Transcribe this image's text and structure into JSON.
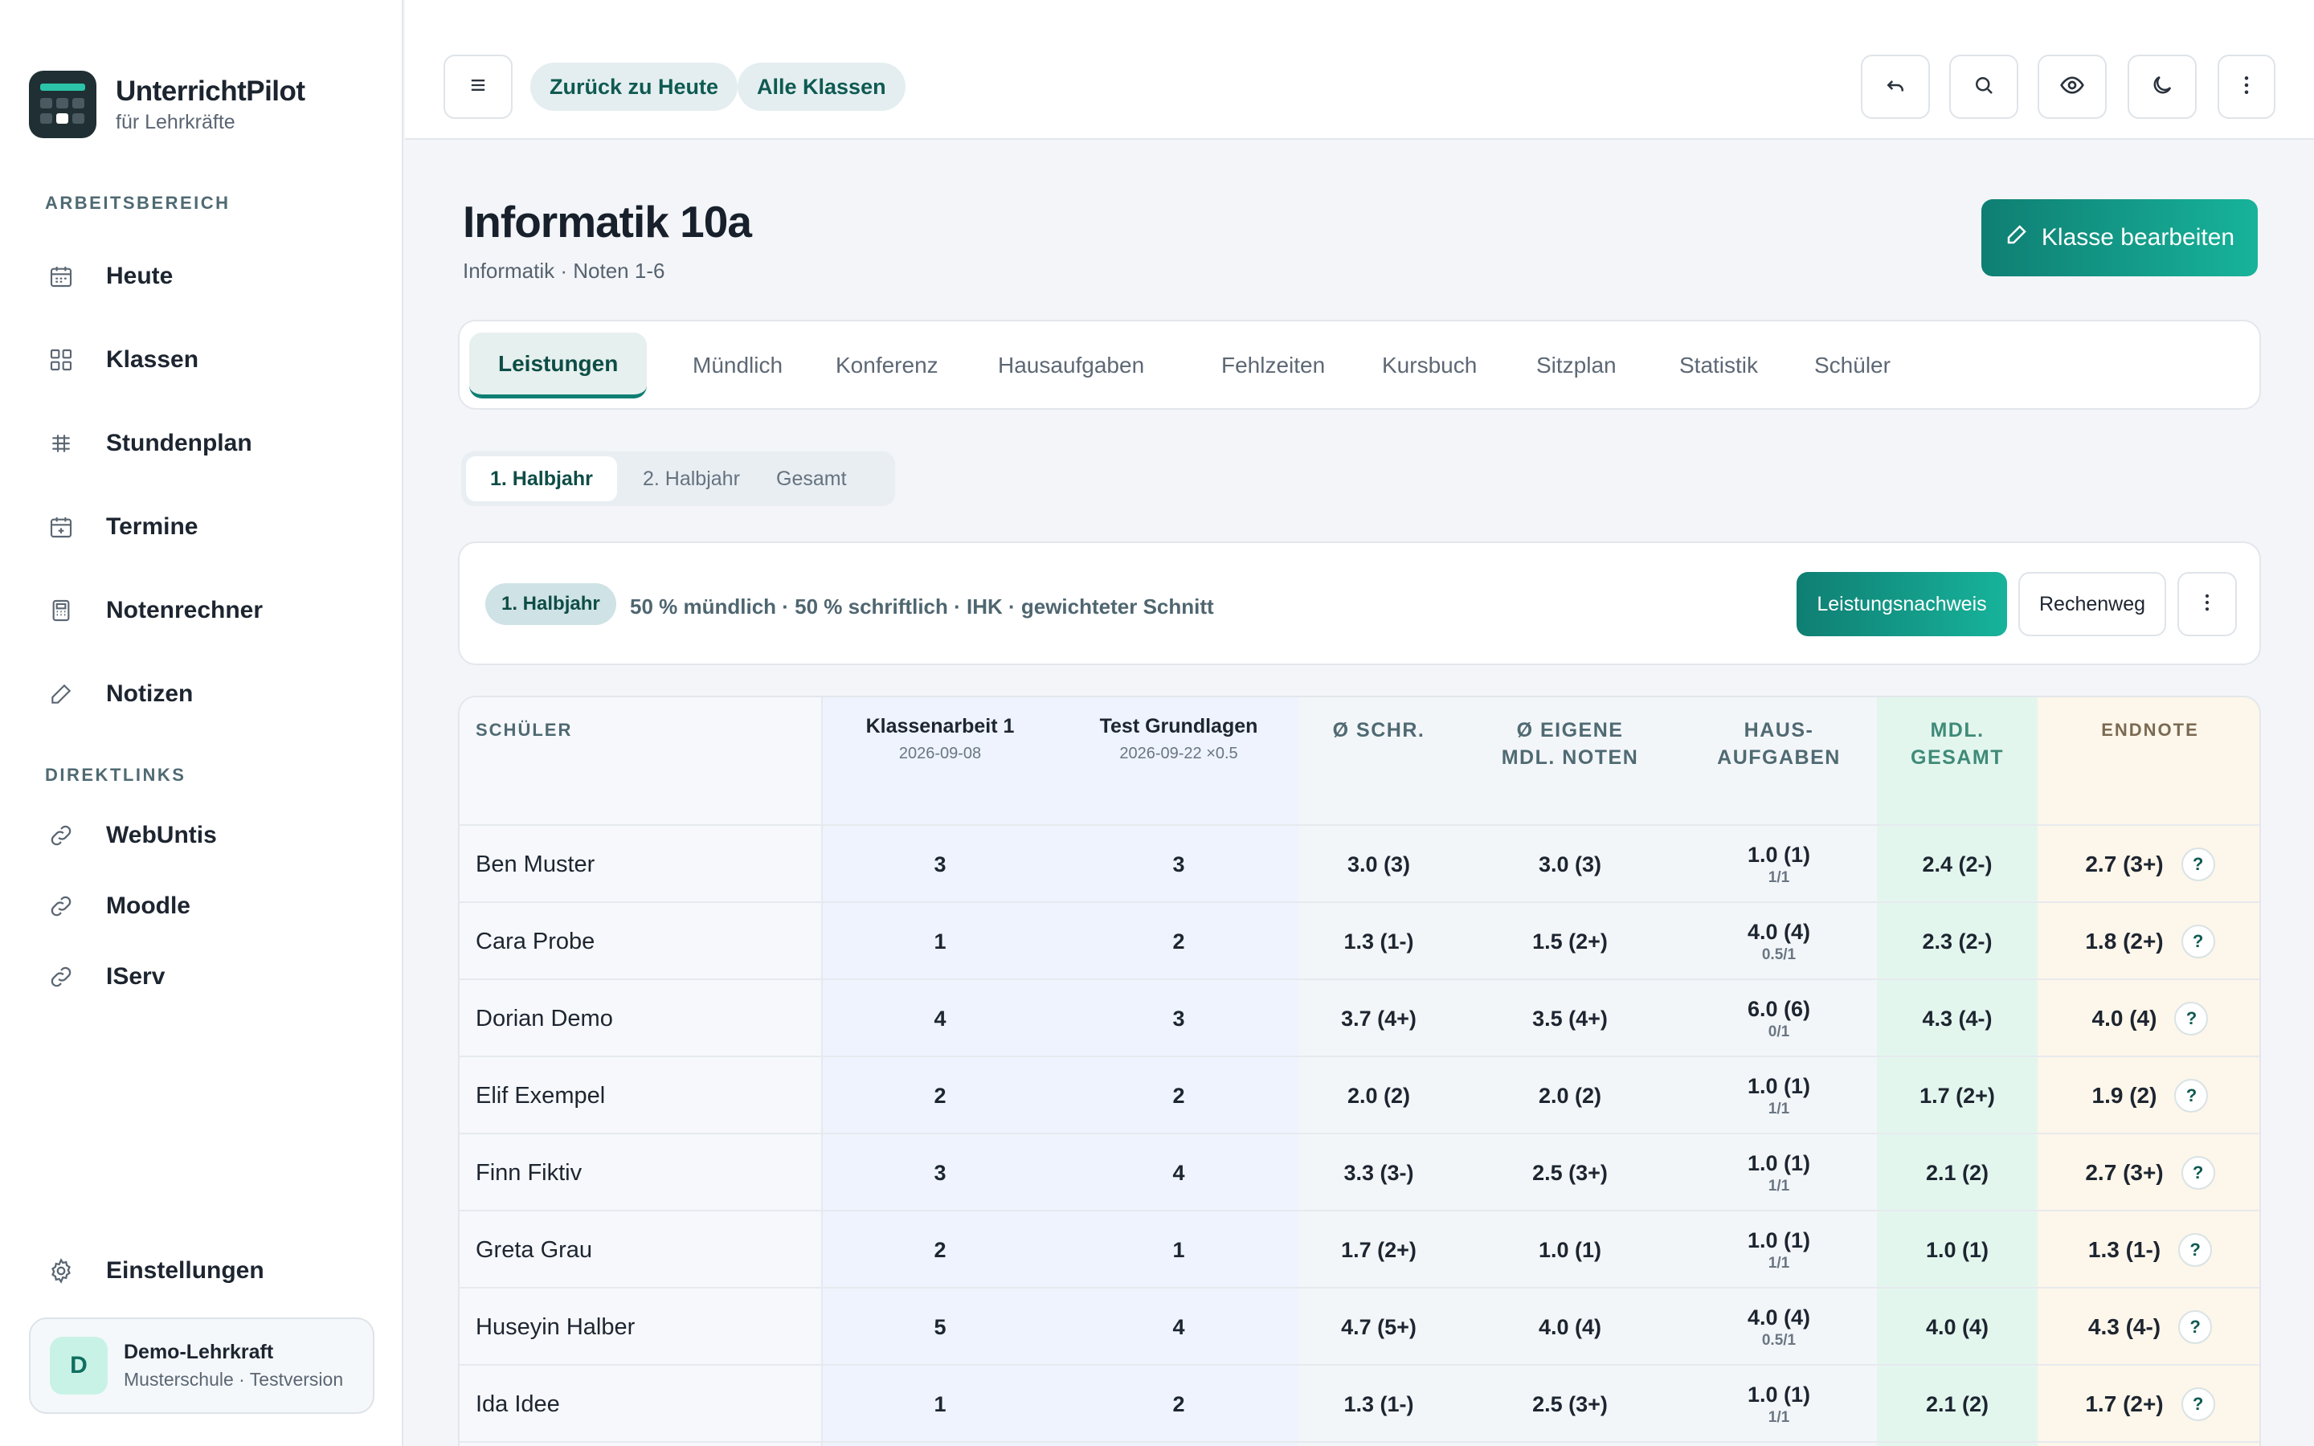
{
  "brand": {
    "title": "UnterrichtPilot",
    "subtitle": "für Lehrkräfte"
  },
  "sidebar": {
    "section_work": "ARBEITSBEREICH",
    "items": [
      {
        "label": "Heute",
        "icon": "calendar-icon"
      },
      {
        "label": "Klassen",
        "icon": "grid-icon"
      },
      {
        "label": "Stundenplan",
        "icon": "timetable-icon"
      },
      {
        "label": "Termine",
        "icon": "calendar-plus-icon"
      },
      {
        "label": "Notenrechner",
        "icon": "calculator-icon"
      },
      {
        "label": "Notizen",
        "icon": "pencil-icon"
      }
    ],
    "section_links": "DIREKTLINKS",
    "links": [
      {
        "label": "WebUntis",
        "icon": "link-icon"
      },
      {
        "label": "Moodle",
        "icon": "link-icon"
      },
      {
        "label": "IServ",
        "icon": "link-icon"
      }
    ],
    "settings_label": "Einstellungen",
    "user": {
      "initial": "D",
      "name": "Demo-Lehrkraft",
      "sub": "Musterschule · Testversion"
    }
  },
  "topbar": {
    "back_today": "Zurück zu Heute",
    "all_classes": "Alle Klassen"
  },
  "page": {
    "title": "Informatik 10a",
    "subtitle": "Informatik · Noten 1-6",
    "edit_button": "Klasse bearbeiten"
  },
  "tabs": [
    "Leistungen",
    "Mündlich",
    "Konferenz",
    "Hausaufgaben",
    "Fehlzeiten",
    "Kursbuch",
    "Sitzplan",
    "Statistik",
    "Schüler"
  ],
  "segments": [
    "1. Halbjahr",
    "2. Halbjahr",
    "Gesamt"
  ],
  "info": {
    "badge": "1. Halbjahr",
    "text": "50 % mündlich · 50 % schriftlich · IHK · gewichteter Schnitt",
    "primary_button": "Leistungsnachweis",
    "secondary_button": "Rechenweg"
  },
  "table": {
    "headers": {
      "student": "SCHÜLER",
      "exam1_title": "Klassenarbeit 1",
      "exam1_date": "2026-09-08",
      "exam2_title": "Test Grundlagen",
      "exam2_date": "2026-09-22 ×0.5",
      "avg_written": "Ø SCHR.",
      "avg_oral": "Ø EIGENE\nMDL. NOTEN",
      "homework": "HAUS-\nAUFGABEN",
      "oral_total": "MDL.\nGESAMT",
      "final": "ENDNOTE"
    },
    "rows": [
      {
        "name": "Ben Muster",
        "e1": "3",
        "e2": "3",
        "schr": "3.0 (3)",
        "mdl": "3.0 (3)",
        "hw": "1.0 (1)",
        "hw_sub": "1/1",
        "mdl_total": "2.4 (2-)",
        "final": "2.7 (3+)"
      },
      {
        "name": "Cara Probe",
        "e1": "1",
        "e2": "2",
        "schr": "1.3 (1-)",
        "mdl": "1.5 (2+)",
        "hw": "4.0 (4)",
        "hw_sub": "0.5/1",
        "mdl_total": "2.3 (2-)",
        "final": "1.8 (2+)"
      },
      {
        "name": "Dorian Demo",
        "e1": "4",
        "e2": "3",
        "schr": "3.7 (4+)",
        "mdl": "3.5 (4+)",
        "hw": "6.0 (6)",
        "hw_sub": "0/1",
        "mdl_total": "4.3 (4-)",
        "final": "4.0 (4)"
      },
      {
        "name": "Elif Exempel",
        "e1": "2",
        "e2": "2",
        "schr": "2.0 (2)",
        "mdl": "2.0 (2)",
        "hw": "1.0 (1)",
        "hw_sub": "1/1",
        "mdl_total": "1.7 (2+)",
        "final": "1.9 (2)"
      },
      {
        "name": "Finn Fiktiv",
        "e1": "3",
        "e2": "4",
        "schr": "3.3 (3-)",
        "mdl": "2.5 (3+)",
        "hw": "1.0 (1)",
        "hw_sub": "1/1",
        "mdl_total": "2.1 (2)",
        "final": "2.7 (3+)"
      },
      {
        "name": "Greta Grau",
        "e1": "2",
        "e2": "1",
        "schr": "1.7 (2+)",
        "mdl": "1.0 (1)",
        "hw": "1.0 (1)",
        "hw_sub": "1/1",
        "mdl_total": "1.0 (1)",
        "final": "1.3 (1-)"
      },
      {
        "name": "Huseyin Halber",
        "e1": "5",
        "e2": "4",
        "schr": "4.7 (5+)",
        "mdl": "4.0 (4)",
        "hw": "4.0 (4)",
        "hw_sub": "0.5/1",
        "mdl_total": "4.0 (4)",
        "final": "4.3 (4-)"
      },
      {
        "name": "Ida Idee",
        "e1": "1",
        "e2": "2",
        "schr": "1.3 (1-)",
        "mdl": "2.5 (3+)",
        "hw": "1.0 (1)",
        "hw_sub": "1/1",
        "mdl_total": "2.1 (2)",
        "final": "1.7 (2+)"
      }
    ],
    "help_glyph": "?"
  },
  "colors": {
    "accent": "#0f7e73",
    "accent_light": "#17b39a",
    "exam_col": "#eef3fd",
    "oral_total_col": "#e3f6ee",
    "final_col": "#fdf6ea"
  }
}
